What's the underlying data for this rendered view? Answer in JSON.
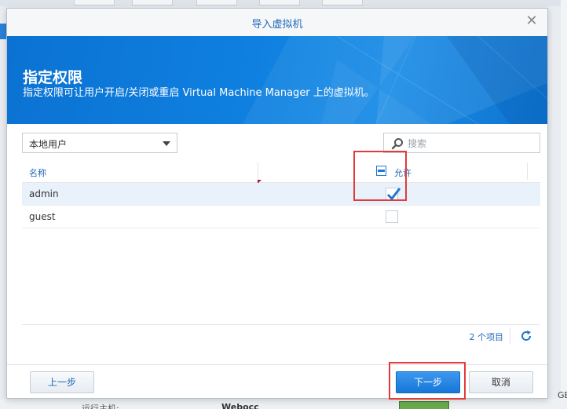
{
  "dialog": {
    "title": "导入虚拟机",
    "close_icon": "close-icon"
  },
  "banner": {
    "heading": "指定权限",
    "subtitle": "指定权限可让用户开启/关闭或重启 Virtual Machine Manager 上的虚拟机。"
  },
  "toolbar": {
    "user_type_selected": "本地用户",
    "search_placeholder": "搜索"
  },
  "grid": {
    "columns": {
      "name": "名称",
      "allow": "允许"
    },
    "header_allow_state": "partial",
    "rows": [
      {
        "name": "admin",
        "allowed": true
      },
      {
        "name": "guest",
        "allowed": false
      }
    ],
    "item_count": "2 个项目"
  },
  "buttons": {
    "prev": "上一步",
    "next": "下一步",
    "cancel": "取消"
  },
  "background": {
    "bottom_label": "运行主机:",
    "bottom_value": "Webocc",
    "right_fragment": "GB"
  },
  "colors": {
    "accent": "#1f78d1",
    "banner": "#0f80e0",
    "highlight": "#e23b3b"
  }
}
